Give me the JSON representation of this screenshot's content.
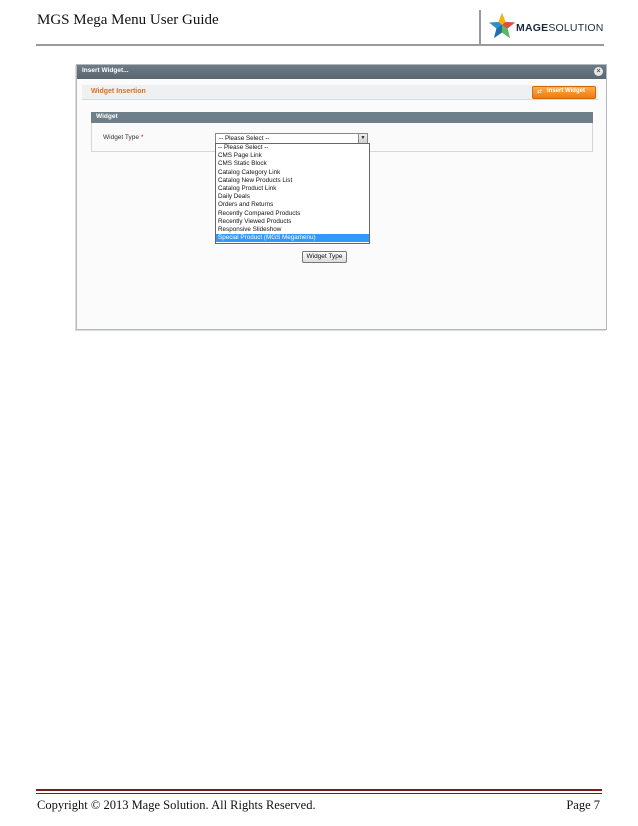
{
  "header": {
    "doc_title": "MGS Mega Menu User Guide",
    "logo": {
      "mage": "MAGE",
      "solution": "SOLUTION",
      "icon": "star-logo-icon"
    }
  },
  "screenshot": {
    "dialog_title": "Insert Widget...",
    "close_icon": "close-icon",
    "section_title": "Widget Insertion",
    "insert_button_label": "Insert Widget",
    "fieldset_title": "Widget",
    "widget_type_label": "Widget Type",
    "required_mark": "*",
    "select_value": "-- Please Select --",
    "options": [
      "-- Please Select --",
      "CMS Page Link",
      "CMS Static Block",
      "Catalog Category Link",
      "Catalog New Products List",
      "Catalog Product Link",
      "Daily Deals",
      "Orders and Returns",
      "Recently Compared Products",
      "Recently Viewed Products",
      "Responsive Slideshow",
      "Special Product (MGS Megamenu)"
    ],
    "selected_option": "Special Product (MGS Megamenu)",
    "widget_type_button_label": "Widget Type",
    "colors": {
      "accent_orange": "#e36f1a",
      "highlight": "#3399ff",
      "header_gray": "#6f7f89"
    }
  },
  "footer": {
    "copyright": "Copyright © 2013 Mage Solution. All Rights Reserved.",
    "page": "Page 7"
  }
}
